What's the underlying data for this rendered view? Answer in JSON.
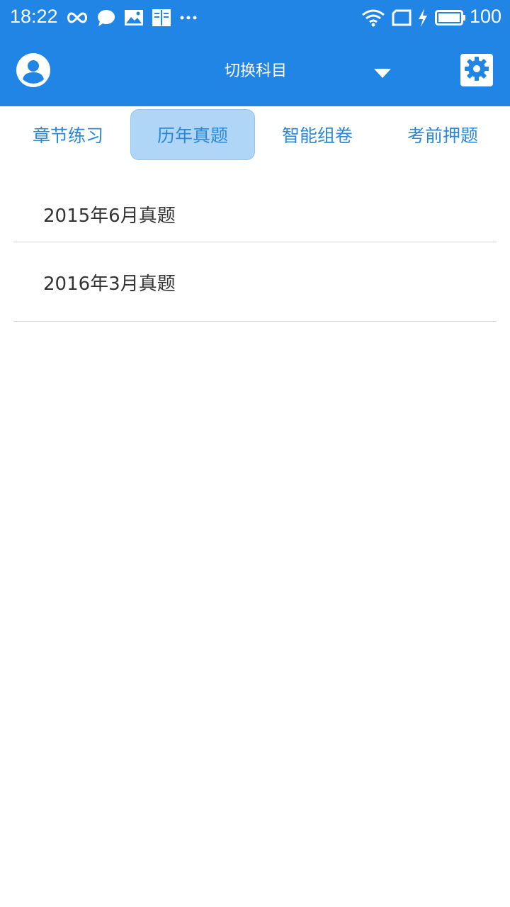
{
  "status_bar": {
    "time": "18:22",
    "battery": "100",
    "icons": [
      "infinity-icon",
      "chat-bubble-icon",
      "image-icon",
      "reader-icon",
      "more-dots-icon",
      "wifi-icon",
      "screen-icon",
      "charging-icon",
      "battery-icon"
    ]
  },
  "app_bar": {
    "subject_label": "切换科目",
    "left_icon": "user-avatar-icon",
    "right_icon": "settings-gear-icon",
    "dropdown_icon": "dropdown-triangle-icon"
  },
  "tabs": [
    {
      "label": "章节练习",
      "active": false
    },
    {
      "label": "历年真题",
      "active": true
    },
    {
      "label": "智能组卷",
      "active": false
    },
    {
      "label": "考前押题",
      "active": false
    }
  ],
  "exams": [
    {
      "title": "2015年6月真题"
    },
    {
      "title": "2016年3月真题"
    }
  ],
  "colors": {
    "primary": "#2185e6",
    "tab_text": "#2b88d8",
    "tab_active_bg": "#afd5f7",
    "divider": "#d6d6d6"
  }
}
